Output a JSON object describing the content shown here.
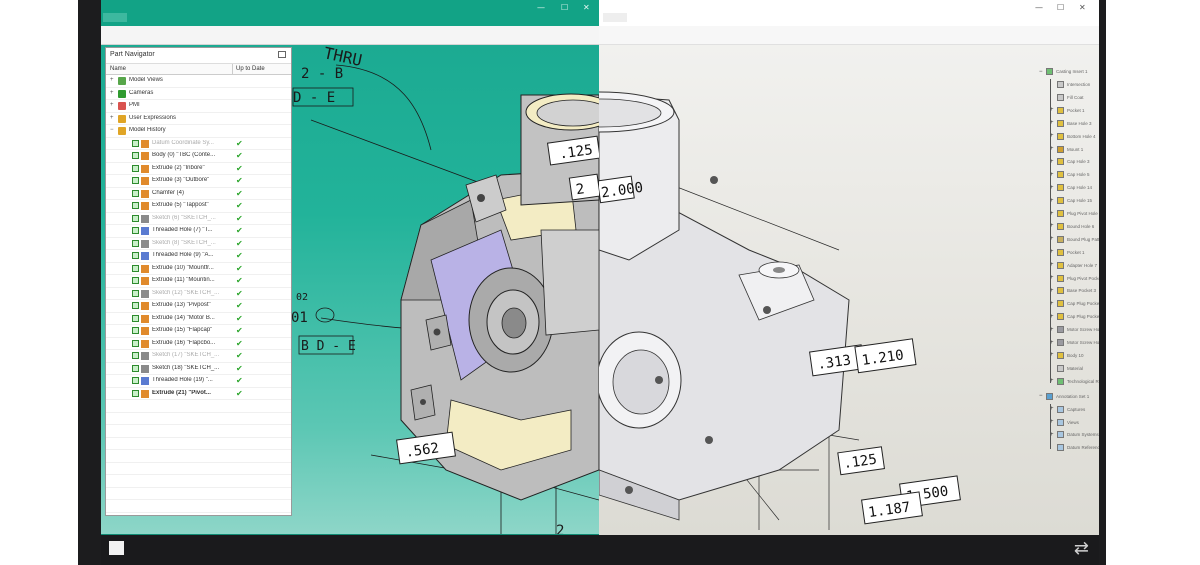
{
  "left_window": {
    "title": "",
    "tabs": [
      "",
      ""
    ],
    "controls": [
      "—",
      "☐",
      "✕"
    ]
  },
  "right_window": {
    "title": "",
    "tabs": [
      "",
      ""
    ],
    "controls": [
      "—",
      "☐",
      "✕"
    ]
  },
  "part_navigator": {
    "title": "Part Navigator",
    "columns": {
      "name": "Name",
      "status": "Up to Date"
    },
    "groups": [
      {
        "label": "Model Views",
        "expander": "+"
      },
      {
        "label": "Cameras",
        "expander": "+"
      },
      {
        "label": "PMI",
        "expander": "+"
      },
      {
        "label": "User Expressions",
        "expander": "+"
      },
      {
        "label": "Model History",
        "expander": "−"
      }
    ],
    "history": [
      {
        "label": "Datum Coordinate Sy...",
        "style": "grey",
        "ok": "✔"
      },
      {
        "label": "Body (0) \"TBC (Conte...",
        "style": "normal",
        "ok": "✔"
      },
      {
        "label": "Extrude (2) \"Inbore\"",
        "style": "normal",
        "ok": "✔"
      },
      {
        "label": "Extrude (3) \"Outbore\"",
        "style": "normal",
        "ok": "✔"
      },
      {
        "label": "Chamfer (4)",
        "style": "normal",
        "ok": "✔"
      },
      {
        "label": "Extrude (5) \"Tappost\"",
        "style": "normal",
        "ok": "✔"
      },
      {
        "label": "Sketch (6) \"SKETCH_...",
        "style": "grey",
        "ok": "✔"
      },
      {
        "label": "Threaded Hole (7) \"T...",
        "style": "normal",
        "ok": "✔"
      },
      {
        "label": "Sketch (8) \"SKETCH_...",
        "style": "grey",
        "ok": "✔"
      },
      {
        "label": "Threaded Hole (9) \"A...",
        "style": "normal",
        "ok": "✔"
      },
      {
        "label": "Extrude (10) \"Mountfr...",
        "style": "normal",
        "ok": "✔"
      },
      {
        "label": "Extrude (11) \"Mountin...",
        "style": "normal",
        "ok": "✔"
      },
      {
        "label": "Sketch (12) \"SKETCH_...",
        "style": "grey",
        "ok": "✔"
      },
      {
        "label": "Extrude (13) \"Pivpost\"",
        "style": "normal",
        "ok": "✔"
      },
      {
        "label": "Extrude (14) \"Motor B...",
        "style": "normal",
        "ok": "✔"
      },
      {
        "label": "Extrude (15) \"Flapcap\"",
        "style": "normal",
        "ok": "✔"
      },
      {
        "label": "Extrude (16) \"Flapcbo...",
        "style": "normal",
        "ok": "✔"
      },
      {
        "label": "Sketch (17) \"SKETCH_...",
        "style": "grey",
        "ok": "✔"
      },
      {
        "label": "Sketch (18) \"SKETCH_...",
        "style": "normal",
        "ok": "✔"
      },
      {
        "label": "Threaded Hole (19) \"...",
        "style": "normal",
        "ok": "✔"
      },
      {
        "label": "Extrude (21) \"Pivot...",
        "style": "bold",
        "ok": "✔"
      }
    ]
  },
  "drawing_annotations": {
    "thru": "THRU",
    "left_frame_1": "2 - B",
    "left_frame_2": "D - E",
    "left_frame_3": "B D - E",
    "dim_125_top": ".125",
    "dim_2000": "2.000",
    "dim_562": ".562",
    "dim_313": ".313",
    "dim_1210": "1.210",
    "dim_125_bot": ".125",
    "dim_1500": "1.500",
    "dim_1187": "1.187",
    "side_01": "01",
    "side_02": "02",
    "side_2": "2"
  },
  "spec_tree": {
    "root": "Casting Insert 1",
    "items": [
      {
        "label": "Intersection",
        "plus": ""
      },
      {
        "label": "Fill Coat",
        "plus": ""
      },
      {
        "label": "Pocket 1",
        "plus": "+"
      },
      {
        "label": "Base Hole 3",
        "plus": "+"
      },
      {
        "label": "Bottom Hole 4",
        "plus": "+"
      },
      {
        "label": "Mount 1",
        "plus": "+"
      },
      {
        "label": "Cap Hole 3",
        "plus": "+"
      },
      {
        "label": "Cap Hole 5",
        "plus": "+"
      },
      {
        "label": "Cap Hole 14",
        "plus": "+"
      },
      {
        "label": "Cap Hole 15",
        "plus": "+"
      },
      {
        "label": "Plug Pivot Hole 3",
        "plus": "+"
      },
      {
        "label": "Bound Hole 6",
        "plus": "+"
      },
      {
        "label": "Bound Plug Pattern 1",
        "plus": "+"
      },
      {
        "label": "Pocket 1",
        "plus": "+"
      },
      {
        "label": "Adapter Hole 7",
        "plus": "+"
      },
      {
        "label": "Plug Pivot Pocket 2",
        "plus": "+"
      },
      {
        "label": "Base Pocket 3",
        "plus": "+"
      },
      {
        "label": "Cap Plug Pocket 4",
        "plus": "+"
      },
      {
        "label": "Cap Plug Pocket 5",
        "plus": "+"
      },
      {
        "label": "Motor Screw Hole 12",
        "plus": "+"
      },
      {
        "label": "Motor Screw Hole 13",
        "plus": "+"
      },
      {
        "label": "Body 10",
        "plus": "+"
      },
      {
        "label": "Material",
        "plus": ""
      },
      {
        "label": "Technological Results",
        "plus": "+"
      }
    ],
    "set_root": "Annotation Set 1",
    "set_items": [
      {
        "label": "Captures",
        "plus": "+"
      },
      {
        "label": "Views",
        "plus": "+"
      },
      {
        "label": "Datum Systems and Datum Targets",
        "plus": "+"
      },
      {
        "label": "Datum Reference Frames",
        "plus": ""
      }
    ]
  },
  "taskbar": {
    "swap": "⇄"
  },
  "colors": {
    "teal": "#1aa890",
    "part_grey": "#bdbdbd",
    "face_yellow": "#f3ecc4",
    "face_lavender": "#b9b2e6"
  }
}
